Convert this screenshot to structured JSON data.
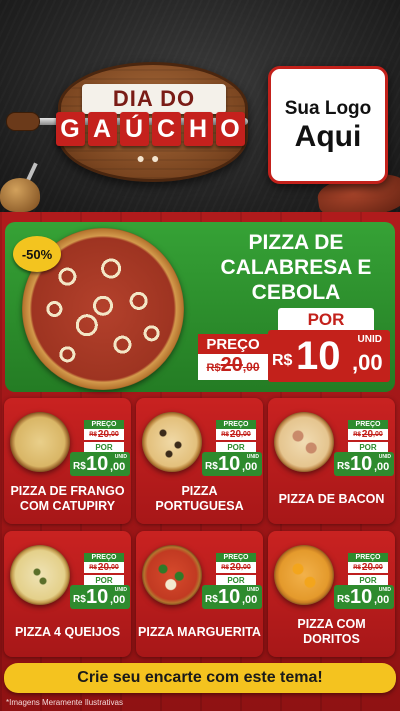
{
  "header": {
    "logo_title_line1": "DIA DO",
    "logo_title_line2_letters": [
      "G",
      "A",
      "Ú",
      "C",
      "H",
      "O"
    ],
    "logo_placeholder_line1": "Sua Logo",
    "logo_placeholder_line2": "Aqui"
  },
  "featured": {
    "discount_badge": "-50%",
    "name": "PIZZA DE CALABRESA E CEBOLA",
    "price": {
      "preco_label": "PREÇO",
      "old_currency": "R$",
      "old_amount": "20",
      "old_cents": ",00",
      "por_label": "POR",
      "unid_label": "UNID",
      "new_currency": "R$",
      "new_amount": "10",
      "new_cents": ",00"
    }
  },
  "products": [
    {
      "name": "PIZZA DE FRANGO COM CATUPIRY",
      "preco_label": "PREÇO",
      "old_currency": "R$",
      "old_amount": "20",
      "old_cents": ",00",
      "por_label": "POR",
      "unid_label": "UNID",
      "new_currency": "R$",
      "new_amount": "10",
      "new_cents": ",00"
    },
    {
      "name": "PIZZA PORTUGUESA",
      "preco_label": "PREÇO",
      "old_currency": "R$",
      "old_amount": "20",
      "old_cents": ",00",
      "por_label": "POR",
      "unid_label": "UNID",
      "new_currency": "R$",
      "new_amount": "10",
      "new_cents": ",00"
    },
    {
      "name": "PIZZA DE BACON",
      "preco_label": "PREÇO",
      "old_currency": "R$",
      "old_amount": "20",
      "old_cents": ",00",
      "por_label": "POR",
      "unid_label": "UNID",
      "new_currency": "R$",
      "new_amount": "10",
      "new_cents": ",00"
    },
    {
      "name": "PIZZA 4 QUEIJOS",
      "preco_label": "PREÇO",
      "old_currency": "R$",
      "old_amount": "20",
      "old_cents": ",00",
      "por_label": "POR",
      "unid_label": "UNID",
      "new_currency": "R$",
      "new_amount": "10",
      "new_cents": ",00"
    },
    {
      "name": "PIZZA MARGUERITA",
      "preco_label": "PREÇO",
      "old_currency": "R$",
      "old_amount": "20",
      "old_cents": ",00",
      "por_label": "POR",
      "unid_label": "UNID",
      "new_currency": "R$",
      "new_amount": "10",
      "new_cents": ",00"
    },
    {
      "name": "PIZZA COM DORITOS",
      "preco_label": "PREÇO",
      "old_currency": "R$",
      "old_amount": "20",
      "old_cents": ",00",
      "por_label": "POR",
      "unid_label": "UNID",
      "new_currency": "R$",
      "new_amount": "10",
      "new_cents": ",00"
    }
  ],
  "cta": {
    "label": "Crie seu encarte com este tema!"
  },
  "footer": {
    "disclaimer": "*Imagens Meramente Ilustrativas"
  },
  "colors": {
    "brand_red": "#c3211b",
    "brand_green": "#2e8b2e",
    "cta_yellow": "#f4c31f"
  },
  "icons": {
    "pizza_image": "pizza-icon",
    "discount_badge": "badge-icon",
    "gourd": "chimarrao-icon",
    "meat": "churrasco-icon"
  }
}
